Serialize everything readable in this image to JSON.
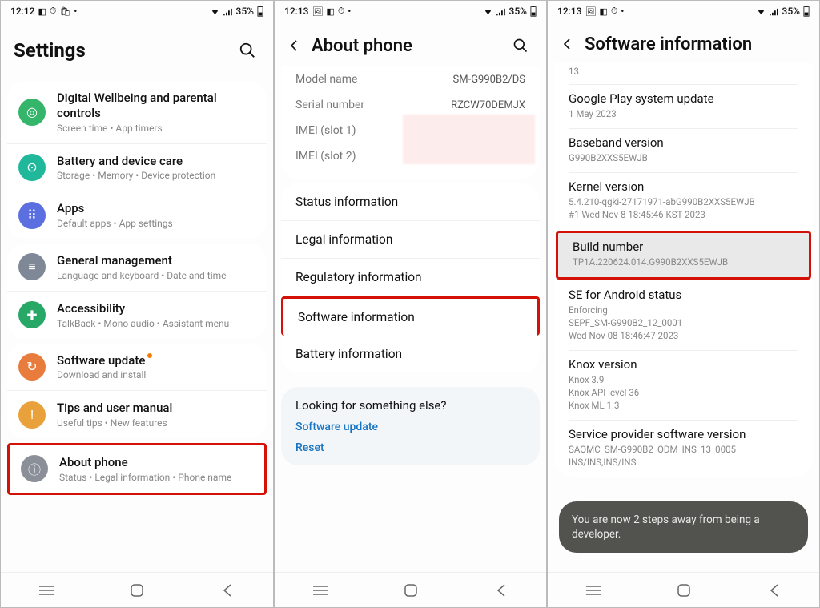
{
  "status": {
    "time1": "12:12",
    "time2": "12:13",
    "time3": "12:13",
    "battery": "35%"
  },
  "screen1": {
    "title": "Settings",
    "items": [
      {
        "title": "Digital Wellbeing and parental controls",
        "sub": "Screen time  •  App timers",
        "color": "#34b56a"
      },
      {
        "title": "Battery and device care",
        "sub": "Storage  •  Memory  •  Device protection",
        "color": "#1fb89a"
      },
      {
        "title": "Apps",
        "sub": "Default apps  •  App settings",
        "color": "#5b6fe0"
      },
      {
        "title": "General management",
        "sub": "Language and keyboard  •  Date and time",
        "color": "#7e8896"
      },
      {
        "title": "Accessibility",
        "sub": "TalkBack  •  Mono audio  •  Assistant menu",
        "color": "#27a866"
      },
      {
        "title": "Software update",
        "sub": "Download and install",
        "color": "#e77c3c",
        "badge": true
      },
      {
        "title": "Tips and user manual",
        "sub": "Useful tips  •  New features",
        "color": "#e9a23b"
      },
      {
        "title": "About phone",
        "sub": "Status  •  Legal information  •  Phone name",
        "color": "#8a8f98",
        "highlight": true
      }
    ]
  },
  "screen2": {
    "title": "About phone",
    "kv": [
      {
        "k": "Model name",
        "v": "SM-G990B2/DS"
      },
      {
        "k": "Serial number",
        "v": "RZCW70DEMJX"
      },
      {
        "k": "IMEI (slot 1)",
        "v": ""
      },
      {
        "k": "IMEI (slot 2)",
        "v": ""
      }
    ],
    "rows": [
      "Status information",
      "Legal information",
      "Regulatory information",
      "Software information",
      "Battery information"
    ],
    "looking": {
      "title": "Looking for something else?",
      "links": [
        "Software update",
        "Reset"
      ]
    }
  },
  "screen3": {
    "title": "Software information",
    "topval": "13",
    "blocks": [
      {
        "title": "Google Play system update",
        "sub": "1 May 2023"
      },
      {
        "title": "Baseband version",
        "sub": "G990B2XXS5EWJB"
      },
      {
        "title": "Kernel version",
        "sub": "5.4.210-qgki-27171971-abG990B2XXS5EWJB\n#1 Wed Nov 8 18:45:46 KST 2023"
      },
      {
        "title": "Build number",
        "sub": "TP1A.220624.014.G990B2XXS5EWJB",
        "highlight": true
      },
      {
        "title": "SE for Android status",
        "sub": "Enforcing\nSEPF_SM-G990B2_12_0001\nWed Nov 08 18:46:47 2023"
      },
      {
        "title": "Knox version",
        "sub": "Knox 3.9\nKnox API level 36\nKnox ML 1.3"
      },
      {
        "title": "Service provider software version",
        "sub": "SAOMC_SM-G990B2_ODM_INS_13_0005\nINS/INS,INS/INS"
      }
    ],
    "toast": "You are now 2 steps away from being a developer."
  }
}
